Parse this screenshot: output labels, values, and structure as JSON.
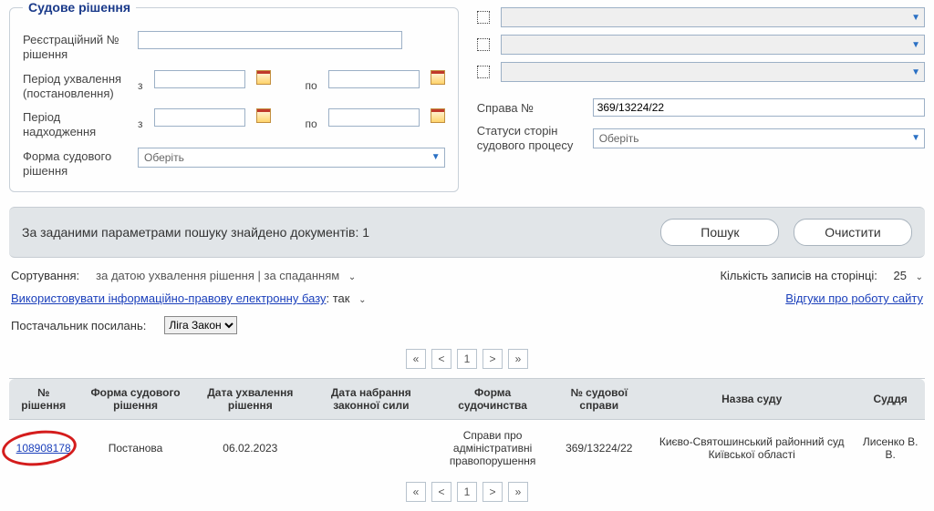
{
  "court_decision": {
    "legend": "Судове рішення",
    "reg_no_label": "Реєстраційний № рішення",
    "period_adopt_label": "Період ухвалення (постановлення)",
    "period_receipt_label": "Період надходження",
    "form_label": "Форма судового рішення",
    "from": "з",
    "to": "по",
    "choose": "Оберіть"
  },
  "right_panel": {
    "case_no_label": "Справа №",
    "case_no_value": "369/13224/22",
    "party_status_label": "Статуси сторін судового процесу",
    "choose": "Оберіть"
  },
  "results_bar": {
    "text": "За заданими параметрами пошуку знайдено документів: 1",
    "search_btn": "Пошук",
    "clear_btn": "Очистити"
  },
  "sorting": {
    "label": "Сортування:",
    "value": "за датою ухвалення рішення | за спаданням"
  },
  "page_size": {
    "label": "Кількість записів на сторінці:",
    "value": "25"
  },
  "link_row": {
    "db_link_text": "Використовувати інформаційно-правову електронну базу",
    "db_link_suffix": ": так",
    "feedback_link": "Відгуки про роботу сайту"
  },
  "supplier": {
    "label": "Постачальник посилань:",
    "value": "Ліга Закон"
  },
  "pager": {
    "first": "«",
    "prev": "<",
    "page": "1",
    "next": ">",
    "last": "»"
  },
  "table": {
    "headers": {
      "no": "№ рішення",
      "form": "Форма судового рішення",
      "adopt_date": "Дата ухвалення рішення",
      "force_date": "Дата набрання законної сили",
      "proceeding": "Форма судочинства",
      "case_no": "№ судової справи",
      "court_name": "Назва суду",
      "judge": "Суддя"
    },
    "row": {
      "no": "108908178",
      "form": "Постанова",
      "adopt_date": "06.02.2023",
      "force_date": "",
      "proceeding": "Справи про адміністративні правопорушення",
      "case_no": "369/13224/22",
      "court_name": "Києво-Святошинський районний суд Київської області",
      "judge": "Лисенко В. В."
    }
  }
}
